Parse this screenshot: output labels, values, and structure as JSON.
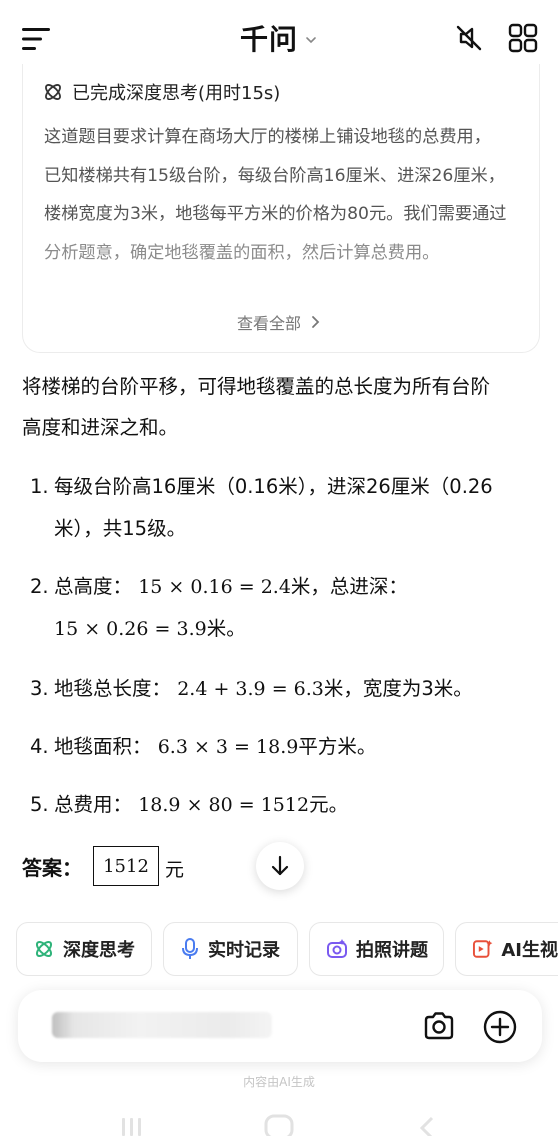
{
  "header": {
    "title": "千问"
  },
  "thinking": {
    "status": "已完成深度思考(用时15s)",
    "lines": [
      "这道题目要求计算在商场大厅的楼梯上铺设地毯的总费用，",
      "已知楼梯共有15级台阶，每级台阶高16厘米、进深26厘米，",
      "楼梯宽度为3米，地毯每平方米的价格为80元。我们需要通过",
      "分析题意，确定地毯覆盖的面积，然后计算总费用。"
    ],
    "view_all": "查看全部"
  },
  "answer": {
    "intro_line1": "将楼梯的台阶平移，可得地毯覆盖的总长度为所有台阶",
    "intro_line2": "高度和进深之和。",
    "steps": [
      {
        "num": "1.",
        "line1": "每级台阶高16厘米（0.16米），进深26厘米（0.26",
        "line2": "米），共15级。"
      },
      {
        "num": "2.",
        "label": "总高度：",
        "math1": "15 × 0.16 = 2.4",
        "text1": "米，总进深：",
        "math2": "15 × 0.26 = 3.9",
        "text2": "米。"
      },
      {
        "num": "3.",
        "label": "地毯总长度：",
        "math": "2.4 + 3.9 = 6.3",
        "text": "米，宽度为3米。"
      },
      {
        "num": "4.",
        "label": "地毯面积：",
        "math": "6.3 × 3 = 18.9",
        "text": "平方米。"
      },
      {
        "num": "5.",
        "label": "总费用：",
        "math": "18.9 × 80 = 1512",
        "text": "元。"
      }
    ],
    "final_label": "答案：",
    "final_value": "1512",
    "final_unit": "元"
  },
  "chips": [
    {
      "label": "深度思考",
      "icon": "deep-think-icon",
      "color": "#2fb37a"
    },
    {
      "label": "实时记录",
      "icon": "microphone-icon",
      "color": "#4a7cf0"
    },
    {
      "label": "拍照讲题",
      "icon": "camera-sparkle-icon",
      "color": "#7a5af0"
    },
    {
      "label": "AI生视",
      "icon": "video-icon",
      "color": "#e8503a"
    }
  ],
  "footer": {
    "disclaimer": "内容由AI生成"
  }
}
